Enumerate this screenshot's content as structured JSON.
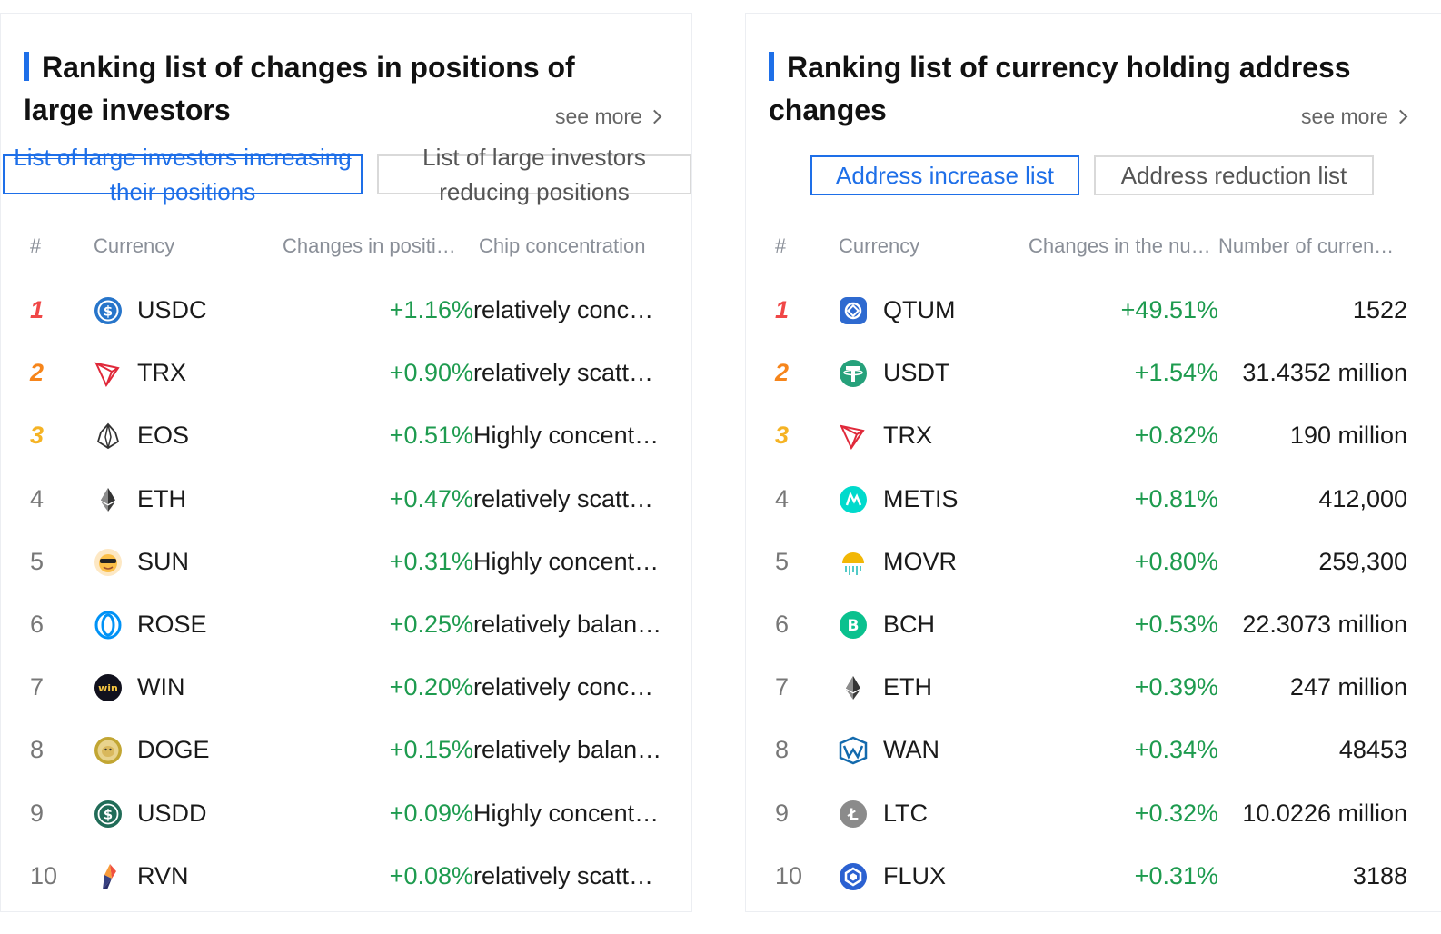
{
  "left": {
    "title": "Ranking list of changes in positions of large investors",
    "see_more": "see more",
    "tabs": [
      {
        "label": "List of large investors increasing their positions",
        "active": true
      },
      {
        "label": "List of large investors reducing positions",
        "active": false
      }
    ],
    "columns": [
      "#",
      "Currency",
      "Changes in positi…",
      "Chip concentration"
    ],
    "rows": [
      {
        "rank": "1",
        "coin": "USDC",
        "icon": "usdc-icon",
        "change": "+1.16%",
        "extra": "relatively conc…"
      },
      {
        "rank": "2",
        "coin": "TRX",
        "icon": "trx-icon",
        "change": "+0.90%",
        "extra": "relatively scatt…"
      },
      {
        "rank": "3",
        "coin": "EOS",
        "icon": "eos-icon",
        "change": "+0.51%",
        "extra": "Highly concent…"
      },
      {
        "rank": "4",
        "coin": "ETH",
        "icon": "eth-icon",
        "change": "+0.47%",
        "extra": "relatively scatt…"
      },
      {
        "rank": "5",
        "coin": "SUN",
        "icon": "sun-icon",
        "change": "+0.31%",
        "extra": "Highly concent…"
      },
      {
        "rank": "6",
        "coin": "ROSE",
        "icon": "rose-icon",
        "change": "+0.25%",
        "extra": "relatively balan…"
      },
      {
        "rank": "7",
        "coin": "WIN",
        "icon": "win-icon",
        "change": "+0.20%",
        "extra": "relatively conc…"
      },
      {
        "rank": "8",
        "coin": "DOGE",
        "icon": "doge-icon",
        "change": "+0.15%",
        "extra": "relatively balan…"
      },
      {
        "rank": "9",
        "coin": "USDD",
        "icon": "usdd-icon",
        "change": "+0.09%",
        "extra": "Highly concent…"
      },
      {
        "rank": "10",
        "coin": "RVN",
        "icon": "rvn-icon",
        "change": "+0.08%",
        "extra": "relatively scatt…"
      }
    ]
  },
  "right": {
    "title": "Ranking list of currency holding address changes",
    "see_more": "see more",
    "tabs": [
      {
        "label": "Address increase list",
        "active": true
      },
      {
        "label": "Address reduction list",
        "active": false
      }
    ],
    "columns": [
      "#",
      "Currency",
      "Changes in the nu…",
      "Number of curren…"
    ],
    "rows": [
      {
        "rank": "1",
        "coin": "QTUM",
        "icon": "qtum-icon",
        "change": "+49.51%",
        "extra": "1522"
      },
      {
        "rank": "2",
        "coin": "USDT",
        "icon": "usdt-icon",
        "change": "+1.54%",
        "extra": "31.4352 million"
      },
      {
        "rank": "3",
        "coin": "TRX",
        "icon": "trx-icon",
        "change": "+0.82%",
        "extra": "190 million"
      },
      {
        "rank": "4",
        "coin": "METIS",
        "icon": "metis-icon",
        "change": "+0.81%",
        "extra": "412,000"
      },
      {
        "rank": "5",
        "coin": "MOVR",
        "icon": "movr-icon",
        "change": "+0.80%",
        "extra": "259,300"
      },
      {
        "rank": "6",
        "coin": "BCH",
        "icon": "bch-icon",
        "change": "+0.53%",
        "extra": "22.3073 million"
      },
      {
        "rank": "7",
        "coin": "ETH",
        "icon": "eth-icon",
        "change": "+0.39%",
        "extra": "247 million"
      },
      {
        "rank": "8",
        "coin": "WAN",
        "icon": "wan-icon",
        "change": "+0.34%",
        "extra": "48453"
      },
      {
        "rank": "9",
        "coin": "LTC",
        "icon": "ltc-icon",
        "change": "+0.32%",
        "extra": "10.0226 million"
      },
      {
        "rank": "10",
        "coin": "FLUX",
        "icon": "flux-icon",
        "change": "+0.31%",
        "extra": "3188"
      }
    ]
  },
  "colors": {
    "accent": "#1e6fe8",
    "positive": "#1e9b4f",
    "rank1": "#f04747",
    "rank2": "#f6851b",
    "rank3": "#f5b324"
  }
}
